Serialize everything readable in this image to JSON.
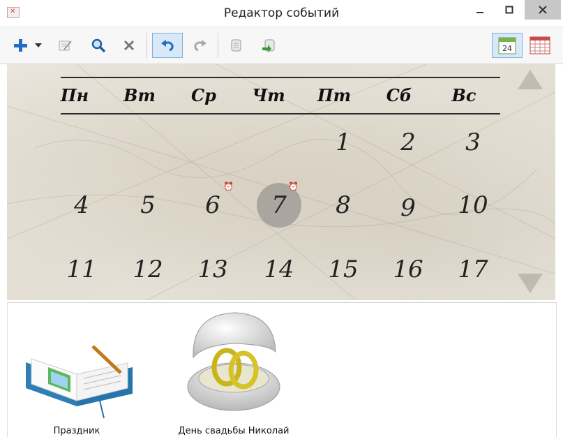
{
  "window": {
    "title": "Редактор событий"
  },
  "toolbar": {
    "buttons": [
      {
        "name": "add",
        "icon": "plus-icon"
      },
      {
        "name": "add-menu",
        "icon": "dropdown-arrow-icon"
      },
      {
        "name": "edit",
        "icon": "edit-icon"
      },
      {
        "name": "find",
        "icon": "magnifier-icon"
      },
      {
        "name": "delete",
        "icon": "x-icon"
      },
      {
        "name": "undo",
        "icon": "undo-icon"
      },
      {
        "name": "redo",
        "icon": "redo-icon"
      },
      {
        "name": "export",
        "icon": "scroll-icon"
      },
      {
        "name": "import",
        "icon": "import-icon"
      }
    ],
    "view_day_label": "24"
  },
  "calendar": {
    "weekdays": [
      "Пн",
      "Вт",
      "Ср",
      "Чт",
      "Пт",
      "Сб",
      "Вс"
    ],
    "weeks": [
      [
        "",
        "",
        "",
        "",
        "1",
        "2",
        "3"
      ],
      [
        "4",
        "5",
        "6",
        "7",
        "8",
        "9",
        "10"
      ],
      [
        "11",
        "12",
        "13",
        "14",
        "15",
        "16",
        "17"
      ]
    ],
    "selected_day": "7",
    "days_with_alarm": [
      "6",
      "7"
    ]
  },
  "events": [
    {
      "label": "Праздник",
      "icon": "open-book-icon"
    },
    {
      "label": "День свадьбы Николай",
      "icon": "wedding-rings-box-icon"
    }
  ],
  "colors": {
    "accent": "#1e6fc4",
    "selected_circle": "#a19e98",
    "calendar_bg": "#e6e2d9"
  }
}
